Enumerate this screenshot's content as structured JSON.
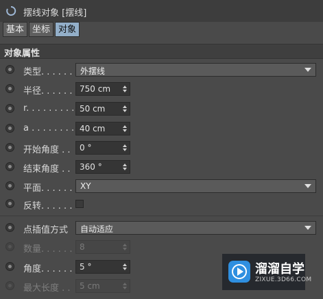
{
  "header": {
    "title": "摆线对象 [摆线]"
  },
  "tabs": [
    {
      "label": "基本",
      "active": false
    },
    {
      "label": "坐标",
      "active": false
    },
    {
      "label": "对象",
      "active": true
    }
  ],
  "section": {
    "title": "对象属性"
  },
  "fields": {
    "type": {
      "label": "类型. . . . . .",
      "value": "外摆线"
    },
    "radius": {
      "label": "半径. . . . . .",
      "value": "750 cm"
    },
    "r": {
      "label": "r. . . . . . . . .",
      "value": "50 cm"
    },
    "a": {
      "label": "a . . . . . . . .",
      "value": "40 cm"
    },
    "start_angle": {
      "label": "开始角度 . .",
      "value": "0 °"
    },
    "end_angle": {
      "label": "结束角度 . .",
      "value": "360 °"
    },
    "plane": {
      "label": "平面. . . . . .",
      "value": "XY"
    },
    "reverse": {
      "label": "反转. . . . . .",
      "checked": false
    },
    "interpolation": {
      "label": "点插值方式",
      "value": "自动适应"
    },
    "count": {
      "label": "数量. . . . . .",
      "value": "8",
      "disabled": true
    },
    "angle": {
      "label": "角度. . . . . .",
      "value": "5 °"
    },
    "max_length": {
      "label": "最大长度 . .",
      "value": "5 cm",
      "disabled": true
    }
  },
  "watermark": {
    "brand": "溜溜自学",
    "url": "ZIXUE.3D66.COM"
  },
  "icons": {
    "title": "spinner-icon",
    "radio": "animation-radio-icon",
    "spin": "stepper-arrows-icon",
    "dropdown": "dropdown-arrow-icon",
    "logo": "play-logo-icon"
  },
  "colors": {
    "panel_bg": "#4a4a4a",
    "active_tab": "#93afc9",
    "field_bg": "#353535",
    "dropdown_bg": "#5a5a5a"
  }
}
